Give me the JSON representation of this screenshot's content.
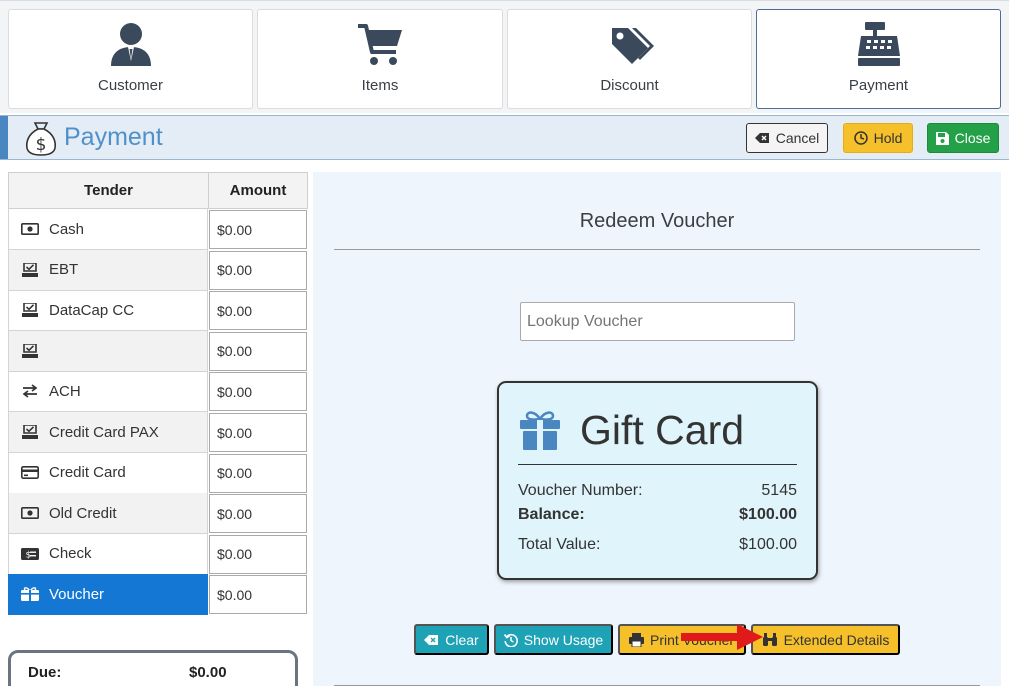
{
  "nav": {
    "tabs": [
      {
        "label": "Customer",
        "icon": "customer-icon"
      },
      {
        "label": "Items",
        "icon": "cart-icon"
      },
      {
        "label": "Discount",
        "icon": "tags-icon"
      },
      {
        "label": "Payment",
        "icon": "cash-register-icon"
      }
    ],
    "active": "Payment"
  },
  "header": {
    "title": "Payment",
    "cancel_label": "Cancel",
    "hold_label": "Hold",
    "close_label": "Close"
  },
  "tender": {
    "col_tender": "Tender",
    "col_amount": "Amount",
    "rows": [
      {
        "label": "Cash",
        "amount": "$0.00",
        "icon": "money-icon"
      },
      {
        "label": "EBT",
        "amount": "$0.00",
        "icon": "card-reader-icon"
      },
      {
        "label": "DataCap CC",
        "amount": "$0.00",
        "icon": "card-reader-icon"
      },
      {
        "label": "",
        "amount": "$0.00",
        "icon": "card-reader-icon"
      },
      {
        "label": "ACH",
        "amount": "$0.00",
        "icon": "exchange-icon"
      },
      {
        "label": "Credit Card PAX",
        "amount": "$0.00",
        "icon": "card-reader-icon"
      },
      {
        "label": "Credit Card",
        "amount": "$0.00",
        "icon": "credit-card-icon"
      },
      {
        "label": "Old Credit",
        "amount": "$0.00",
        "icon": "money-icon"
      },
      {
        "label": "Check",
        "amount": "$0.00",
        "icon": "check-icon"
      },
      {
        "label": "Voucher",
        "amount": "$0.00",
        "icon": "gift-card-icon"
      }
    ],
    "selected": "Voucher"
  },
  "summary": {
    "due_label": "Due:",
    "due_value": "$0.00"
  },
  "voucher": {
    "title": "Redeem Voucher",
    "lookup_placeholder": "Lookup Voucher",
    "card_title": "Gift Card",
    "number_label": "Voucher Number:",
    "number_value": "5145",
    "balance_label": "Balance:",
    "balance_value": "$100.00",
    "total_label": "Total Value:",
    "total_value": "$100.00",
    "clear_label": "Clear",
    "usage_label": "Show Usage",
    "print_label": "Print Voucher",
    "extended_label": "Extended Details"
  },
  "colors": {
    "selected_row": "#1477d4",
    "header_accent": "#4f90c9",
    "teal_button": "#1ea2b5",
    "yellow_button": "#f6c02a",
    "green_button": "#24a148",
    "annotation_arrow": "#e0191a"
  }
}
